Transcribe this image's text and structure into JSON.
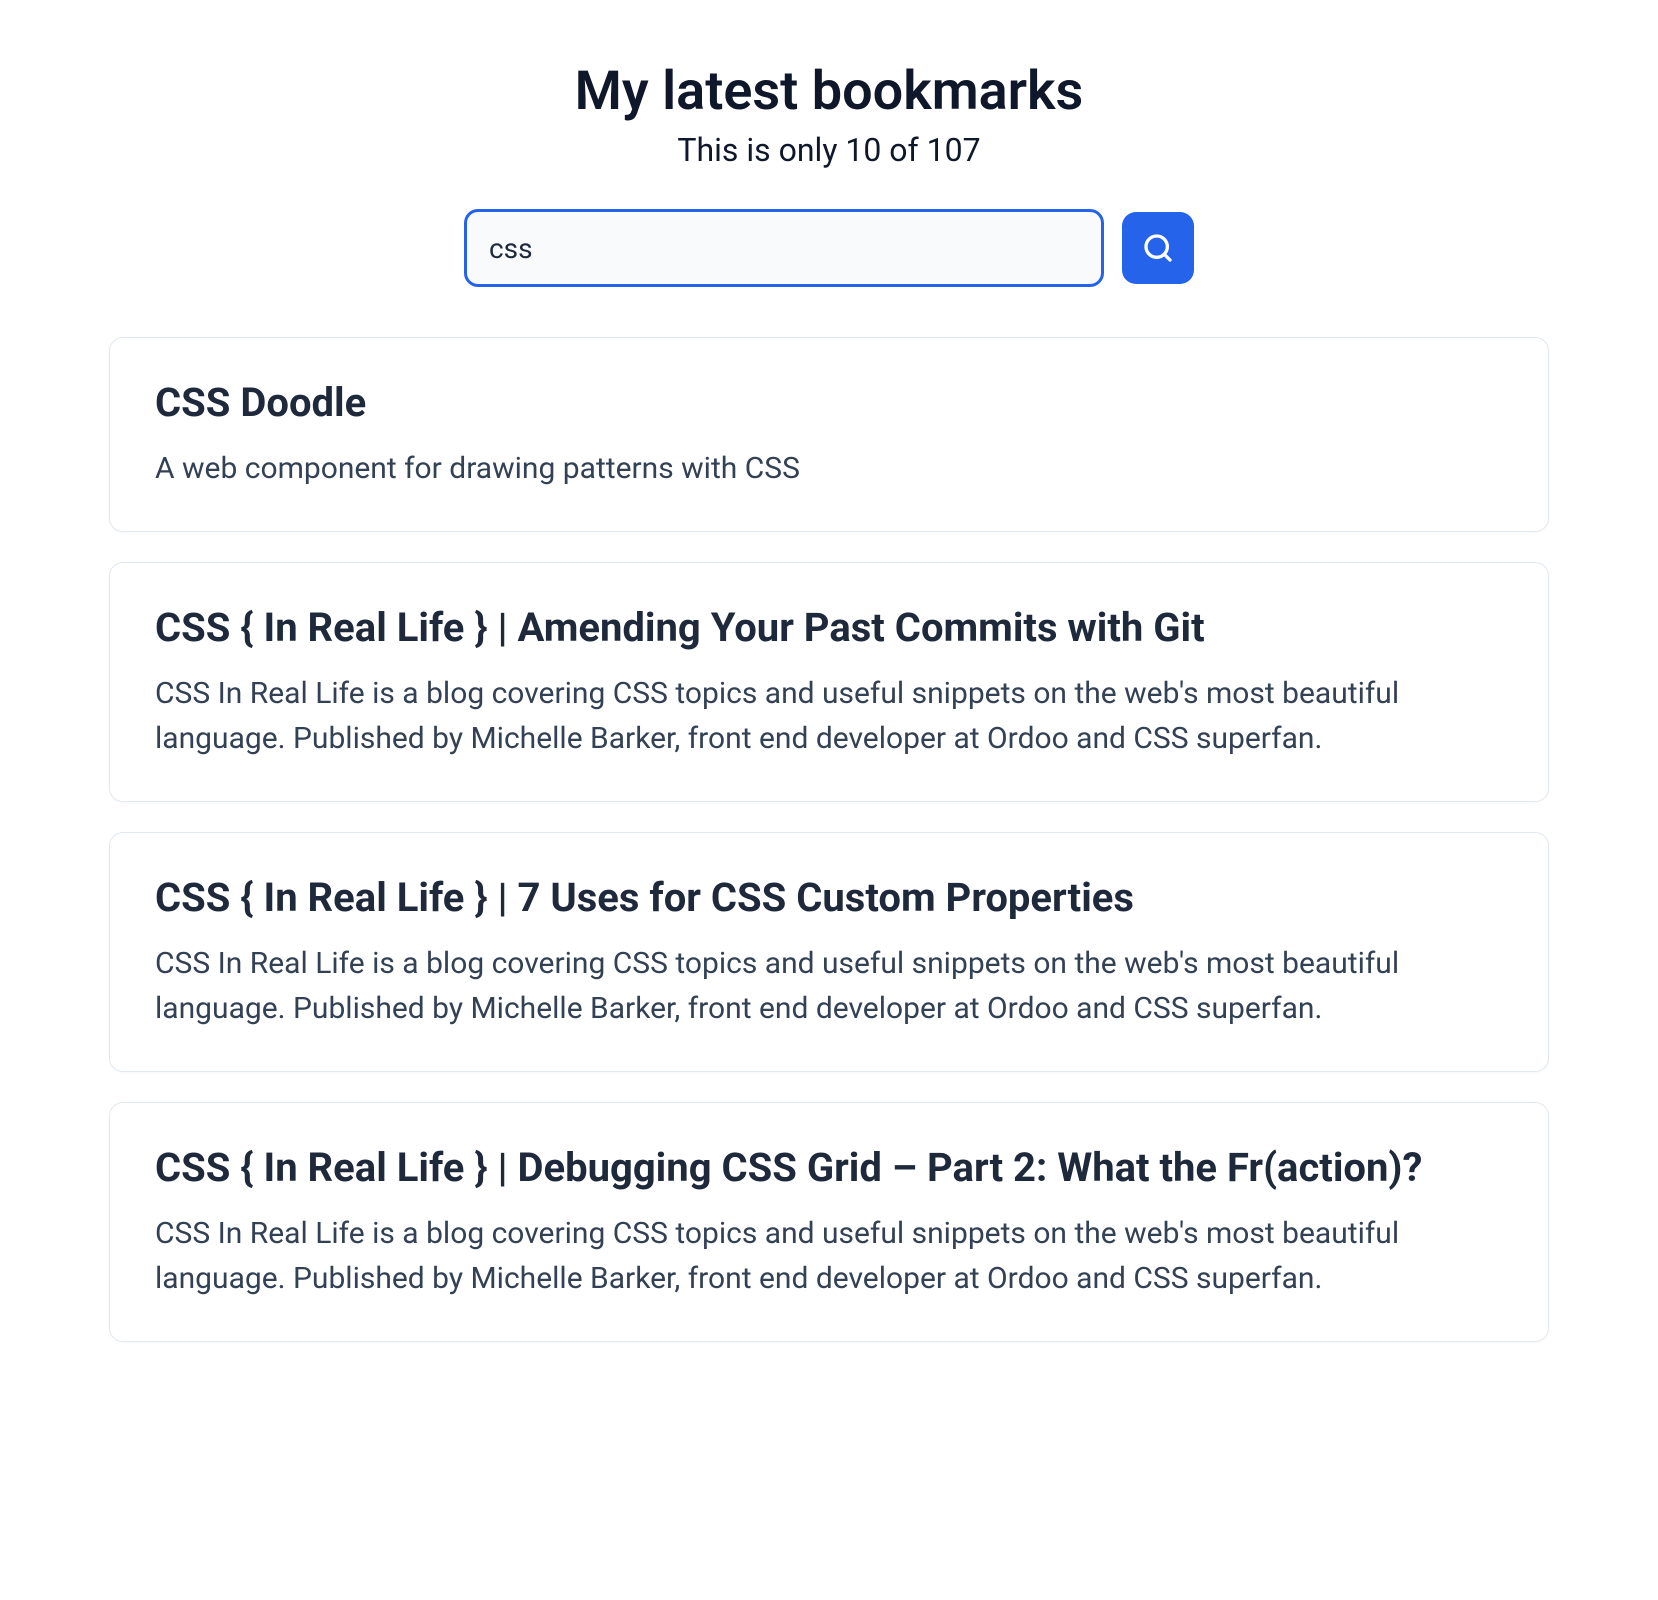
{
  "header": {
    "title": "My latest bookmarks",
    "subtitle": "This is only 10 of 107"
  },
  "search": {
    "value": "css",
    "placeholder": ""
  },
  "bookmarks": [
    {
      "title": "CSS Doodle",
      "description": "A web component for drawing patterns with CSS"
    },
    {
      "title": "CSS { In Real Life } | Amending Your Past Commits with Git",
      "description": "CSS In Real Life is a blog covering CSS topics and useful snippets on the web's most beautiful language. Published by Michelle Barker, front end developer at Ordoo and CSS superfan."
    },
    {
      "title": "CSS { In Real Life } | 7 Uses for CSS Custom Properties",
      "description": "CSS In Real Life is a blog covering CSS topics and useful snippets on the web's most beautiful language. Published by Michelle Barker, front end developer at Ordoo and CSS superfan."
    },
    {
      "title": "CSS { In Real Life } | Debugging CSS Grid – Part 2: What the Fr(action)?",
      "description": "CSS In Real Life is a blog covering CSS topics and useful snippets on the web's most beautiful language. Published by Michelle Barker, front end developer at Ordoo and CSS superfan."
    }
  ]
}
